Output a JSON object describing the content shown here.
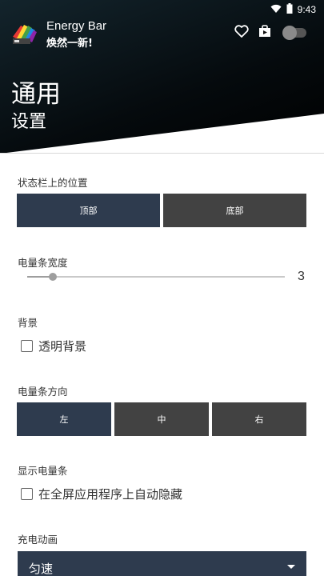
{
  "status_bar": {
    "time": "9:43"
  },
  "app": {
    "title": "Energy Bar",
    "subtitle": "焕然一新!"
  },
  "page": {
    "title": "通用",
    "subtitle": "设置"
  },
  "position": {
    "label": "状态栏上的位置",
    "options": [
      "顶部",
      "底部"
    ],
    "selected": "顶部"
  },
  "width": {
    "label": "电量条宽度",
    "value": "3",
    "fraction": 0.1
  },
  "background": {
    "label": "背景",
    "checkbox_label": "透明背景",
    "checked": false
  },
  "direction": {
    "label": "电量条方向",
    "options": [
      "左",
      "中",
      "右"
    ],
    "selected": "左"
  },
  "display": {
    "label": "显示电量条",
    "checkbox_label": "在全屏应用程序上自动隐藏",
    "checked": false
  },
  "charging": {
    "label": "充电动画",
    "value": "匀速"
  },
  "colors": {
    "accent": "#2e3b4e",
    "inactive": "#424242",
    "header": "#0b1418"
  }
}
